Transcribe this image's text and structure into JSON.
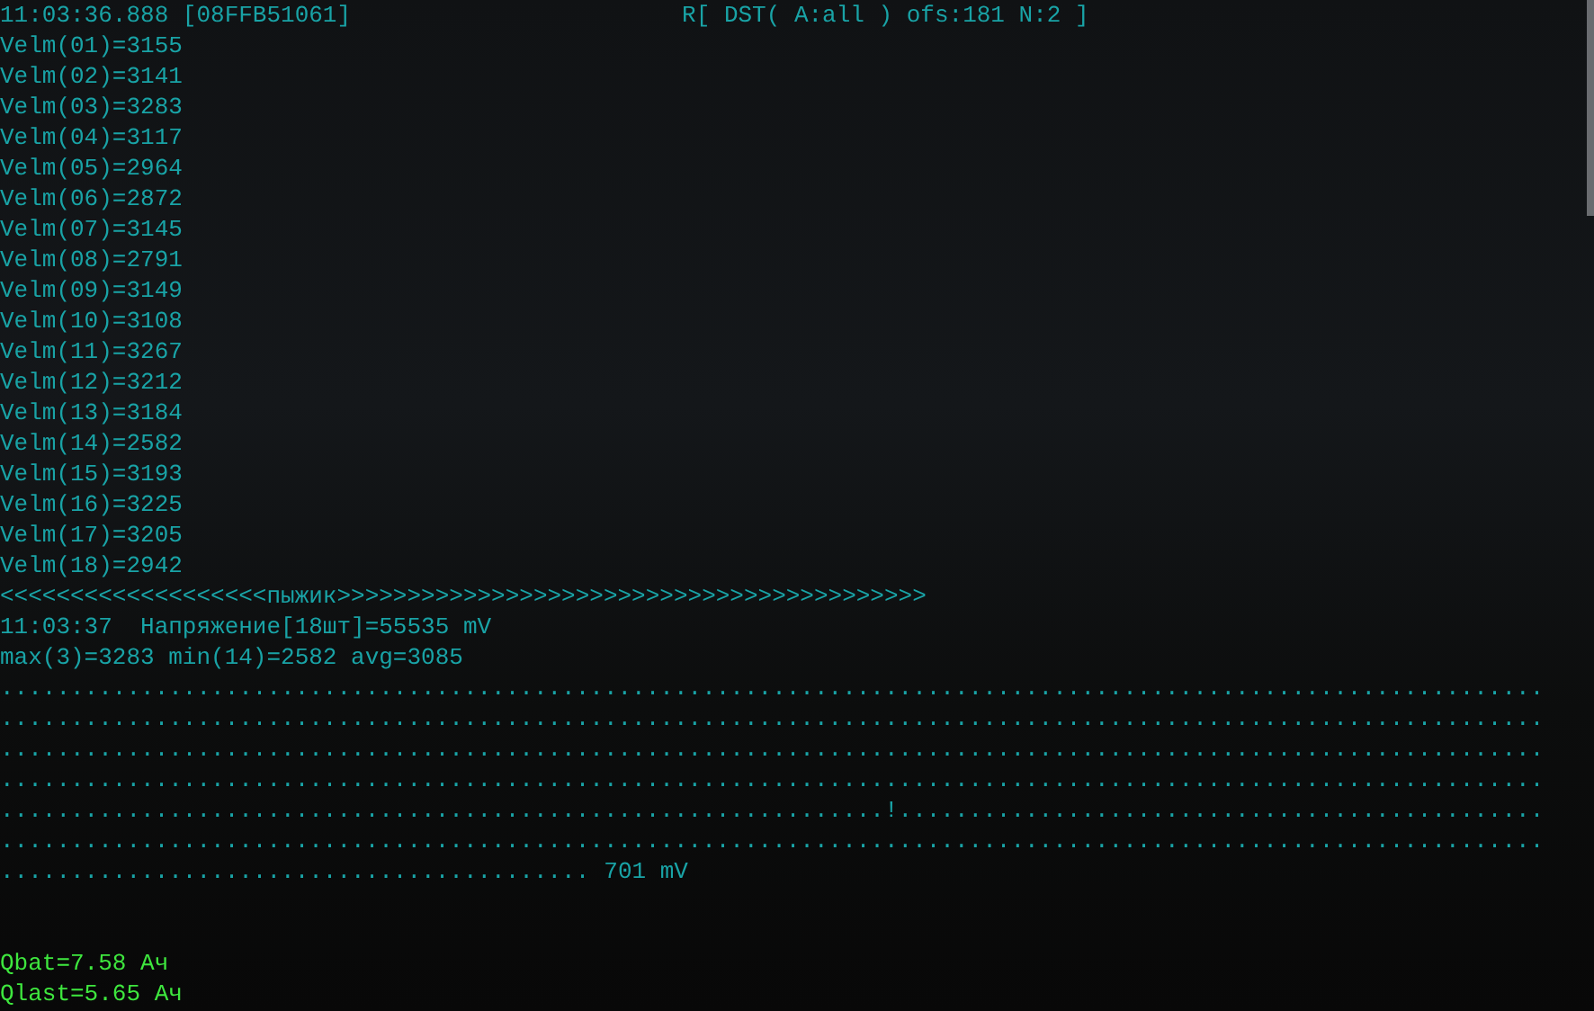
{
  "terminal": {
    "header": {
      "timestamp": "11:03:36.888 [08FFB51061]",
      "status": "R[ DST( A:all ) ofs:181 N:2 ]"
    },
    "readings": [
      "Velm(01)=3155",
      "Velm(02)=3141",
      "Velm(03)=3283",
      "Velm(04)=3117",
      "Velm(05)=2964",
      "Velm(06)=2872",
      "Velm(07)=3145",
      "Velm(08)=2791",
      "Velm(09)=3149",
      "Velm(10)=3108",
      "Velm(11)=3267",
      "Velm(12)=3212",
      "Velm(13)=3184",
      "Velm(14)=2582",
      "Velm(15)=3193",
      "Velm(16)=3225",
      "Velm(17)=3205",
      "Velm(18)=2942"
    ],
    "divider": "<<<<<<<<<<<<<<<<<<<пыжик>>>>>>>>>>>>>>>>>>>>>>>>>>>>>>>>>>>>>>>>>>",
    "stats": [
      "11:03:37  Напряжение[18шт]=55535 mV",
      "max(3)=3283 min(14)=2582 avg=3085"
    ],
    "graph": [
      {
        "dots": ".............................................................................................................."
      },
      {
        "dots": ".............................................................................................................."
      },
      {
        "dots": ".............................................................................................................."
      },
      {
        "dots": ".............................................................................................................."
      },
      {
        "dots": "...............................................................!.............................................."
      },
      {
        "dots": ".............................................................................................................."
      },
      {
        "dots": "..........................................",
        "reading": "701 mV"
      }
    ],
    "battery": [
      "Qbat=7.58 Ач",
      "Qlast=5.65 Ач"
    ]
  }
}
